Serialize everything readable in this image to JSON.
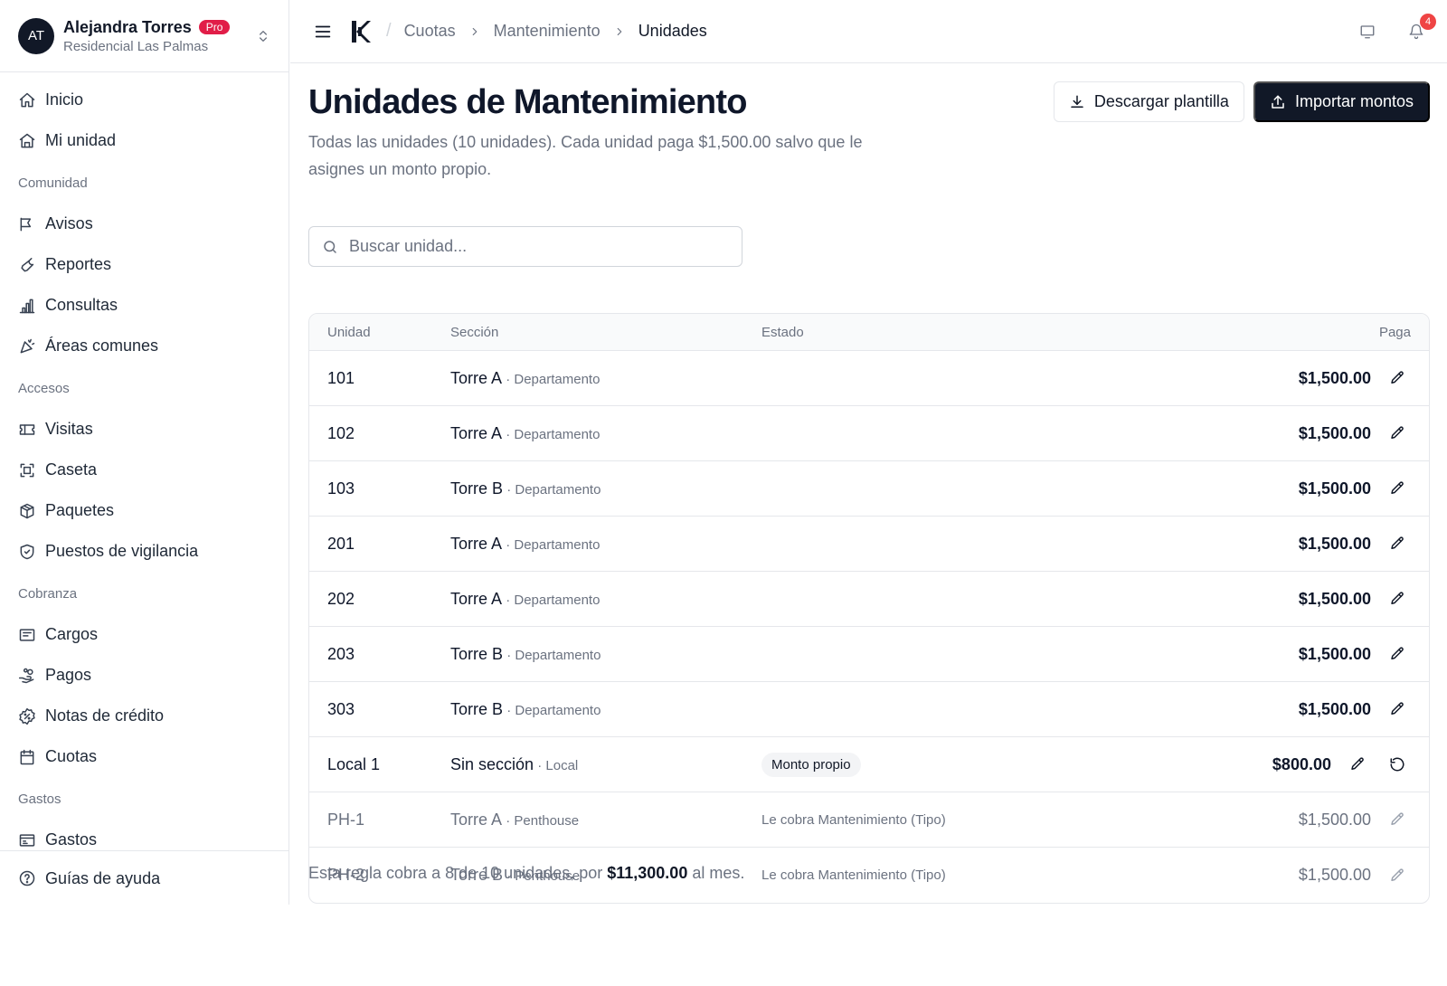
{
  "profile": {
    "initials": "AT",
    "name": "Alejandra Torres",
    "badge": "Pro",
    "community": "Residencial Las Palmas"
  },
  "sidebar": {
    "top_items": [
      {
        "label": "Inicio",
        "icon": "home-icon"
      },
      {
        "label": "Mi unidad",
        "icon": "building-icon"
      }
    ],
    "sections": [
      {
        "title": "Comunidad",
        "items": [
          {
            "label": "Avisos",
            "icon": "megaphone-icon"
          },
          {
            "label": "Reportes",
            "icon": "wrench-icon"
          },
          {
            "label": "Consultas",
            "icon": "bar-chart-icon"
          },
          {
            "label": "Áreas comunes",
            "icon": "party-icon"
          }
        ]
      },
      {
        "title": "Accesos",
        "items": [
          {
            "label": "Visitas",
            "icon": "ticket-icon"
          },
          {
            "label": "Caseta",
            "icon": "scan-icon"
          },
          {
            "label": "Paquetes",
            "icon": "package-icon"
          },
          {
            "label": "Puestos de vigilancia",
            "icon": "shield-icon"
          }
        ]
      },
      {
        "title": "Cobranza",
        "items": [
          {
            "label": "Cargos",
            "icon": "receipt-icon"
          },
          {
            "label": "Pagos",
            "icon": "hand-coins-icon"
          },
          {
            "label": "Notas de crédito",
            "icon": "badge-percent-icon"
          },
          {
            "label": "Cuotas",
            "icon": "calendar-icon"
          }
        ]
      },
      {
        "title": "Gastos",
        "items": [
          {
            "label": "Gastos",
            "icon": "wallet-icon"
          }
        ]
      }
    ],
    "footer_item": {
      "label": "Guías de ayuda",
      "icon": "help-circle-icon"
    }
  },
  "topbar": {
    "breadcrumb": [
      "Cuotas",
      "Mantenimiento",
      "Unidades"
    ],
    "notification_count": "4"
  },
  "page": {
    "title": "Unidades de Mantenimiento",
    "description": "Todas las unidades (10 unidades). Cada unidad paga $1,500.00 salvo que le asignes un monto propio.",
    "download_label": "Descargar plantilla",
    "import_label": "Importar montos",
    "search_placeholder": "Buscar unidad..."
  },
  "table": {
    "headers": {
      "unit": "Unidad",
      "section": "Sección",
      "state": "Estado",
      "pay": "Paga"
    },
    "rows": [
      {
        "unit": "101",
        "section": "Torre A",
        "type": "Departamento",
        "state": "",
        "pay": "$1,500.00",
        "muted": false,
        "own": false
      },
      {
        "unit": "102",
        "section": "Torre A",
        "type": "Departamento",
        "state": "",
        "pay": "$1,500.00",
        "muted": false,
        "own": false
      },
      {
        "unit": "103",
        "section": "Torre B",
        "type": "Departamento",
        "state": "",
        "pay": "$1,500.00",
        "muted": false,
        "own": false
      },
      {
        "unit": "201",
        "section": "Torre A",
        "type": "Departamento",
        "state": "",
        "pay": "$1,500.00",
        "muted": false,
        "own": false
      },
      {
        "unit": "202",
        "section": "Torre A",
        "type": "Departamento",
        "state": "",
        "pay": "$1,500.00",
        "muted": false,
        "own": false
      },
      {
        "unit": "203",
        "section": "Torre B",
        "type": "Departamento",
        "state": "",
        "pay": "$1,500.00",
        "muted": false,
        "own": false
      },
      {
        "unit": "303",
        "section": "Torre B",
        "type": "Departamento",
        "state": "",
        "pay": "$1,500.00",
        "muted": false,
        "own": false
      },
      {
        "unit": "Local 1",
        "section": "Sin sección",
        "type": "Local",
        "state": "Monto propio",
        "pay": "$800.00",
        "muted": false,
        "own": true
      },
      {
        "unit": "PH-1",
        "section": "Torre A",
        "type": "Penthouse",
        "state": "Le cobra Mantenimiento (Tipo)",
        "pay": "$1,500.00",
        "muted": true,
        "own": false
      },
      {
        "unit": "PH-2",
        "section": "Torre B",
        "type": "Penthouse",
        "state": "Le cobra Mantenimiento (Tipo)",
        "pay": "$1,500.00",
        "muted": true,
        "own": false
      }
    ]
  },
  "footer": {
    "prefix": "Esta regla cobra a 8 de 10 unidades, por ",
    "amount": "$11,300.00",
    "suffix": " al mes."
  }
}
